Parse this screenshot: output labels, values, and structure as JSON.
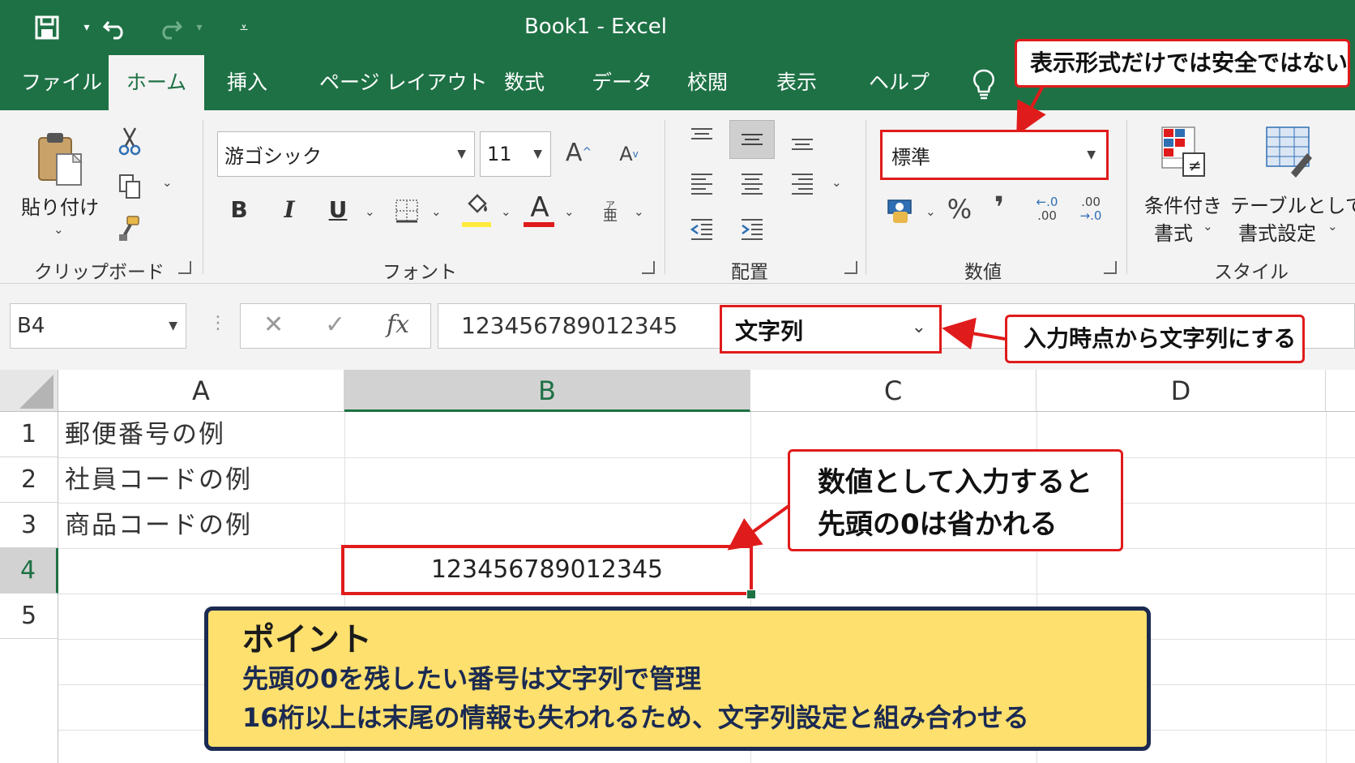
{
  "titlebar": {
    "title": "Book1  -  Excel",
    "icons": [
      "save-icon",
      "undo-icon",
      "redo-icon",
      "customize-qat-icon"
    ]
  },
  "tabs": [
    "ファイル",
    "ホーム",
    "挿入",
    "ページ レイアウト",
    "数式",
    "データ",
    "校閲",
    "表示",
    "ヘルプ"
  ],
  "tell_me": {
    "icon": "lightbulb-icon"
  },
  "ribbon": {
    "clipboard": {
      "paste_label": "貼り付け",
      "group_label": "クリップボード"
    },
    "font": {
      "font_name": "游ゴシック",
      "font_size": "11",
      "grow_label": "A",
      "shrink_label": "A",
      "bold_label": "B",
      "italic_label": "I",
      "underline_label": "U",
      "font_color_label": "A",
      "phonetic_small": "ア",
      "phonetic_big": "亜",
      "group_label": "フォント",
      "fill_color": "#ffeb3b",
      "font_color": "#e01b1b"
    },
    "alignment": {
      "group_label": "配置"
    },
    "number": {
      "format_value": "標準",
      "percent_label": "%",
      "comma_label": "❜",
      "inc_decimal_top": "←.0",
      "inc_decimal_bottom": ".00",
      "dec_decimal_top": ".00",
      "dec_decimal_bottom": "→.0",
      "group_label": "数値"
    },
    "styles": {
      "conditional_line1": "条件付き",
      "conditional_line2": "書式",
      "table_line1": "テーブルとして",
      "table_line2": "書式設定",
      "group_label": "スタイル"
    }
  },
  "formula_bar": {
    "name_box": "B4",
    "cancel_label": "✕",
    "enter_label": "✓",
    "fx_label": "fx",
    "formula": "123456789012345"
  },
  "grid": {
    "columns": [
      "A",
      "B",
      "C",
      "D"
    ],
    "rows": [
      "1",
      "2",
      "3",
      "4",
      "5"
    ],
    "cells": {
      "A1": "郵便番号の例",
      "A2": "社員コードの例",
      "A3": "商品コードの例",
      "B4": "123456789012345"
    }
  },
  "annotations": {
    "format_warning": "表示形式だけでは安全ではない",
    "format_dropdown": "文字列",
    "input_tip": "入力時点から文字列にする",
    "numeric_line1": "数値として入力すると",
    "numeric_line2": "先頭の0は省かれる"
  },
  "point": {
    "title": "ポイント",
    "line1": "先頭の0を残したい番号は文字列で管理",
    "line2": "16桁以上は末尾の情報も失われるため、文字列設定と組み合わせる"
  },
  "colors": {
    "excel_green": "#1e7145",
    "annotation_red": "#e01b1b",
    "point_bg": "#fde06e",
    "point_border": "#1b2a52"
  }
}
